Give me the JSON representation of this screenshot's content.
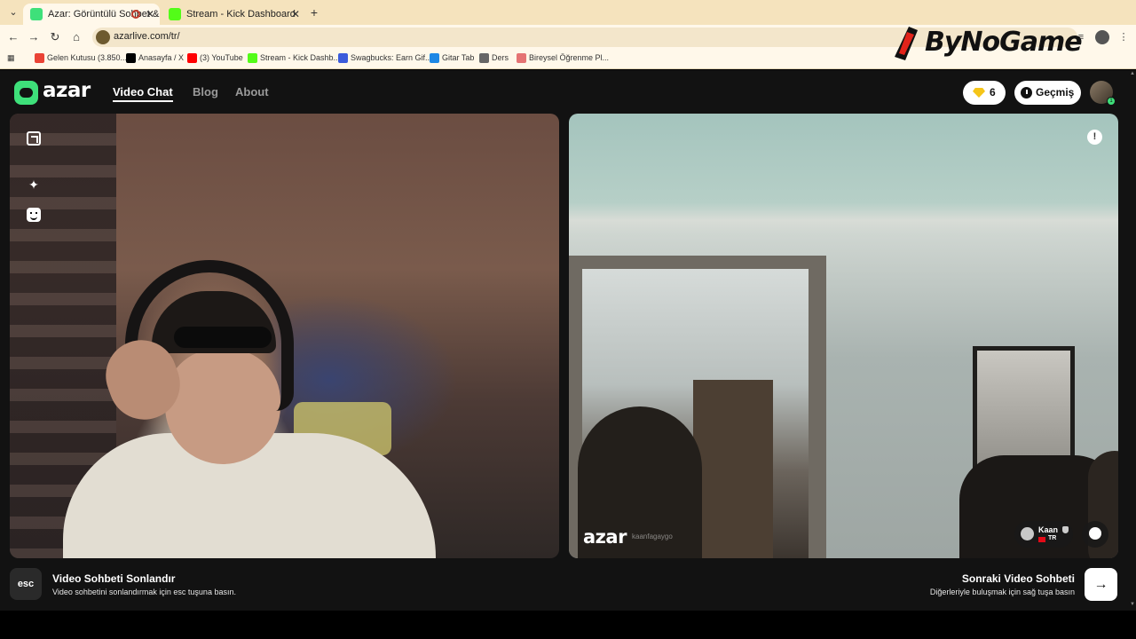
{
  "browser": {
    "tabs": [
      {
        "title": "Azar: Görüntülü Sohbet & Y",
        "favicon_color": "#3ee07a",
        "active": true
      },
      {
        "title": "Stream - Kick Dashboard",
        "favicon_color": "#53fc18",
        "active": false
      }
    ],
    "new_tab_label": "+",
    "url": "azarlive.com/tr/",
    "bookmarks": [
      {
        "label": "Gelen Kutusu (3.850...",
        "icon_color": "#ea4335"
      },
      {
        "label": "Anasayfa / X",
        "icon_color": "#000000"
      },
      {
        "label": "(3) YouTube",
        "icon_color": "#ff0000"
      },
      {
        "label": "Stream - Kick Dashb...",
        "icon_color": "#53fc18"
      },
      {
        "label": "Swagbucks: Earn Gif...",
        "icon_color": "#3b5bdb"
      },
      {
        "label": "Gitar Tab",
        "icon_color": "#1e88e5"
      },
      {
        "label": "Ders",
        "icon_color": "#666666"
      },
      {
        "label": "Bireysel Öğrenme Pl...",
        "icon_color": "#e57373"
      }
    ]
  },
  "watermark": {
    "text": "ByNoGame"
  },
  "app": {
    "logo_text": "azar",
    "nav": {
      "video_chat": "Video Chat",
      "blog": "Blog",
      "about": "About"
    },
    "gems": "6",
    "history_label": "Geçmiş",
    "avatar_badge": "1",
    "accent_color": "#3ee07a"
  },
  "remote": {
    "watermark_logo": "azar",
    "watermark_user": "kaanfagaygo",
    "report_icon": "!",
    "peer": {
      "name": "Kaan",
      "country": "TR"
    }
  },
  "bottom": {
    "esc_key": "esc",
    "end_title": "Video Sohbeti Sonlandır",
    "end_sub": "Video sohbetini sonlandırmak için esc tuşuna basın.",
    "next_title": "Sonraki Video Sohbeti",
    "next_sub": "Diğerleriyle buluşmak için sağ tuşa basın",
    "next_arrow": "→"
  }
}
